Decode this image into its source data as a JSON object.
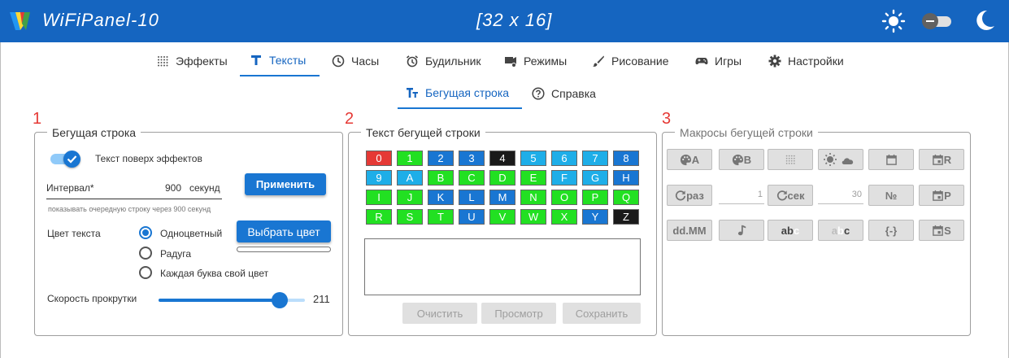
{
  "header": {
    "title": "WiFiPanel-10",
    "matrix_size": "[32 x 16]",
    "colors": {
      "bar": "#1565c0"
    }
  },
  "main_tabs": [
    {
      "label": "Эффекты",
      "icon": "dots-grid-icon"
    },
    {
      "label": "Тексты",
      "icon": "text-t-icon"
    },
    {
      "label": "Часы",
      "icon": "clock-icon"
    },
    {
      "label": "Будильник",
      "icon": "alarm-icon"
    },
    {
      "label": "Режимы",
      "icon": "modes-icon"
    },
    {
      "label": "Рисование",
      "icon": "brush-icon"
    },
    {
      "label": "Игры",
      "icon": "gamepad-icon"
    },
    {
      "label": "Настройки",
      "icon": "gear-icon"
    }
  ],
  "active_main_tab": "Тексты",
  "sub_tabs": [
    {
      "label": "Бегущая строка",
      "icon": "text-size-icon"
    },
    {
      "label": "Справка",
      "icon": "help-circle-icon"
    }
  ],
  "active_sub_tab": "Бегущая строка",
  "panel1": {
    "number": "1",
    "title": "Бегущая строка",
    "overlay_switch": {
      "label": "Текст поверх эффектов",
      "checked": true
    },
    "interval": {
      "label": "Интервал*",
      "value": "900",
      "unit": "секунд",
      "hint": "показывать очередную строку через 900 секунд"
    },
    "apply_button": "Применить",
    "color_label": "Цвет текста",
    "color_options": [
      {
        "label": "Одноцветный",
        "selected": true
      },
      {
        "label": "Радуга",
        "selected": false
      },
      {
        "label": "Каждая буква свой цвет",
        "selected": false
      }
    ],
    "pick_color_button": "Выбрать цвет",
    "speed": {
      "label": "Скорость прокрутки",
      "value": "211",
      "fraction": 0.83
    }
  },
  "panel2": {
    "number": "2",
    "title": "Текст бегущей строки",
    "keys": [
      [
        {
          "t": "0",
          "c": "#e53935"
        },
        {
          "t": "1",
          "c": "#22e022"
        },
        {
          "t": "2",
          "c": "#1976d2"
        },
        {
          "t": "3",
          "c": "#1976d2"
        },
        {
          "t": "4",
          "c": "#1a1a1a"
        },
        {
          "t": "5",
          "c": "#1eaee8"
        },
        {
          "t": "6",
          "c": "#1eaee8"
        },
        {
          "t": "7",
          "c": "#1eaee8"
        },
        {
          "t": "8",
          "c": "#1976d2"
        }
      ],
      [
        {
          "t": "9",
          "c": "#1eaee8"
        },
        {
          "t": "A",
          "c": "#1eaee8"
        },
        {
          "t": "B",
          "c": "#22e022"
        },
        {
          "t": "C",
          "c": "#22e022"
        },
        {
          "t": "D",
          "c": "#22e022"
        },
        {
          "t": "E",
          "c": "#22e022"
        },
        {
          "t": "F",
          "c": "#1eaee8"
        },
        {
          "t": "G",
          "c": "#1eaee8"
        },
        {
          "t": "H",
          "c": "#1976d2"
        }
      ],
      [
        {
          "t": "I",
          "c": "#22e022"
        },
        {
          "t": "J",
          "c": "#22e022"
        },
        {
          "t": "K",
          "c": "#1976d2"
        },
        {
          "t": "L",
          "c": "#1976d2"
        },
        {
          "t": "M",
          "c": "#1976d2"
        },
        {
          "t": "N",
          "c": "#22e022"
        },
        {
          "t": "O",
          "c": "#22e022"
        },
        {
          "t": "P",
          "c": "#22e022"
        },
        {
          "t": "Q",
          "c": "#22e022"
        }
      ],
      [
        {
          "t": "R",
          "c": "#22e022"
        },
        {
          "t": "S",
          "c": "#22e022"
        },
        {
          "t": "T",
          "c": "#22e022"
        },
        {
          "t": "U",
          "c": "#1976d2"
        },
        {
          "t": "V",
          "c": "#22e022"
        },
        {
          "t": "W",
          "c": "#22e022"
        },
        {
          "t": "X",
          "c": "#22e022"
        },
        {
          "t": "Y",
          "c": "#1976d2"
        },
        {
          "t": "Z",
          "c": "#1a1a1a"
        }
      ]
    ],
    "textarea_value": "",
    "buttons": [
      "Очистить",
      "Просмотр",
      "Сохранить"
    ]
  },
  "panel3": {
    "number": "3",
    "title": "Макросы бегущей строки",
    "rows": [
      [
        {
          "kind": "btn",
          "label": "A",
          "icon": "palette-icon"
        },
        {
          "kind": "btn",
          "label": "B",
          "icon": "palette-icon"
        },
        {
          "kind": "btn",
          "label": "",
          "icon": "dots-grid-icon"
        },
        {
          "kind": "btn",
          "label": "",
          "icon": "weather-sun-cloud-icon"
        },
        {
          "kind": "btn",
          "label": "",
          "icon": "calendar-icon"
        },
        {
          "kind": "btn",
          "label": "R",
          "icon": "calendar-event-icon"
        }
      ],
      [
        {
          "kind": "btn",
          "label": "раз",
          "icon": "refresh-icon"
        },
        {
          "kind": "field",
          "value": "1"
        },
        {
          "kind": "btn",
          "label": "сек",
          "icon": "refresh-icon"
        },
        {
          "kind": "field",
          "value": "30"
        },
        {
          "kind": "btn",
          "label": "№",
          "icon": ""
        },
        {
          "kind": "btn",
          "label": "P",
          "icon": "calendar-event-icon"
        }
      ],
      [
        {
          "kind": "btn",
          "label": "dd.MM",
          "icon": ""
        },
        {
          "kind": "btn",
          "label": "",
          "icon": "music-note-icon"
        },
        {
          "kind": "btn",
          "label": "abc",
          "icon": "",
          "style": "abc1"
        },
        {
          "kind": "btn",
          "label": "abc",
          "icon": "",
          "style": "abc2"
        },
        {
          "kind": "btn",
          "label": "{-}",
          "icon": ""
        },
        {
          "kind": "btn",
          "label": "S",
          "icon": "calendar-event-icon"
        }
      ]
    ]
  }
}
